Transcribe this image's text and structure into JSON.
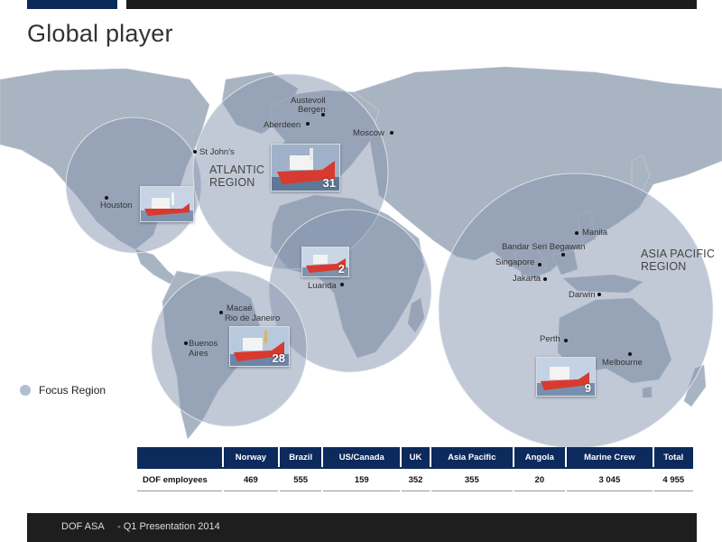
{
  "page": {
    "title": "Global player"
  },
  "map": {
    "regions": {
      "atlantic_line1": "ATLANTIC",
      "atlantic_line2": "REGION",
      "asia_line1": "ASIA PACIFIC",
      "asia_line2": "REGION"
    },
    "cities": {
      "austevoll": "Austevoll",
      "bergen": "Bergen",
      "aberdeen": "Aberdeen",
      "moscow": "Moscow",
      "st_johns": "St John's",
      "houston": "Houston",
      "luanda": "Luanda",
      "macae": "Macaé",
      "rio": "Rio de Janeiro",
      "buenos_aires_1": "Buenos",
      "buenos_aires_2": "Aires",
      "manila": "Manila",
      "bandar": "Bandar Seri Begawan",
      "singapore": "Singapore",
      "jakarta": "Jakarta",
      "darwin": "Darwin",
      "perth": "Perth",
      "melbourne": "Melbourne"
    },
    "vessel_counts": {
      "atlantic": "31",
      "angola": "2",
      "brazil": "28",
      "asia": "9"
    },
    "legend": {
      "label": "Focus Region",
      "color": "#b3bdd1"
    }
  },
  "table": {
    "headers": [
      "",
      "Norway",
      "Brazil",
      "US/Canada",
      "UK",
      "Asia Pacific",
      "Angola",
      "Marine Crew",
      "Total"
    ],
    "row": [
      "DOF employees",
      "469",
      "555",
      "159",
      "352",
      "355",
      "20",
      "3 045",
      "4 955"
    ]
  },
  "footer": {
    "company": "DOF ASA",
    "presentation": "- Q1 Presentation 2014"
  },
  "colors": {
    "header_navy": "#0d2a5c",
    "land": "#a9b4c2",
    "ship_hull": "#d83a2f"
  }
}
